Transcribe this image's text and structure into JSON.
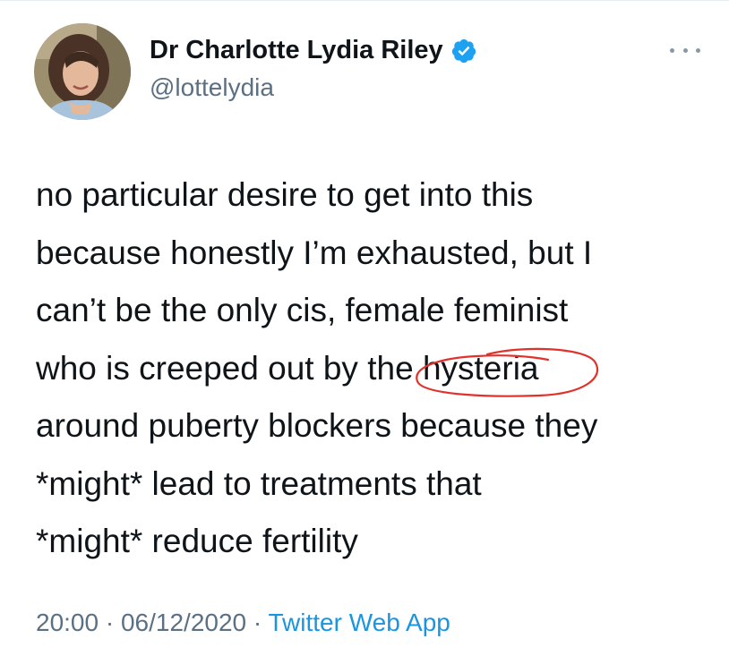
{
  "author": {
    "display_name": "Dr Charlotte Lydia Riley",
    "handle": "@lottelydia",
    "verified": true,
    "verified_icon": "verified-badge-icon"
  },
  "tweet": {
    "lines": [
      "no particular desire to get into this",
      "because honestly I’m exhausted, but I",
      "can’t be the only cis, female feminist",
      "who is creeped out by the ",
      "hysteria",
      "around puberty blockers because they",
      "*might* lead to treatments that",
      "*might* reduce fertility"
    ]
  },
  "meta": {
    "time": "20:00",
    "separator": " · ",
    "date": "06/12/2020",
    "source": "Twitter Web App"
  },
  "colors": {
    "text": "#0f1419",
    "secondary": "#5b7083",
    "link": "#1b95e0",
    "verified": "#1da1f2",
    "annotation": "#e0322b"
  }
}
